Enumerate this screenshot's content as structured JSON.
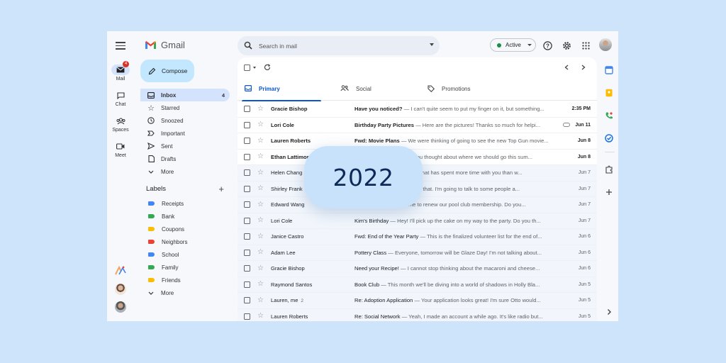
{
  "app": {
    "name": "Gmail"
  },
  "rail": {
    "mail": {
      "label": "Mail",
      "badge": "4"
    },
    "chat": {
      "label": "Chat"
    },
    "spaces": {
      "label": "Spaces"
    },
    "meet": {
      "label": "Meet"
    }
  },
  "compose_label": "Compose",
  "nav": [
    {
      "label": "Inbox",
      "count": "4",
      "icon": "inbox-icon",
      "selected": true
    },
    {
      "label": "Starred",
      "icon": "star-icon"
    },
    {
      "label": "Snoozed",
      "icon": "clock-icon"
    },
    {
      "label": "Important",
      "icon": "important-icon"
    },
    {
      "label": "Sent",
      "icon": "send-icon"
    },
    {
      "label": "Drafts",
      "icon": "draft-icon"
    },
    {
      "label": "More",
      "icon": "chevron-down-icon"
    }
  ],
  "labels": {
    "heading": "Labels",
    "items": [
      {
        "label": "Receipts",
        "color": "#4285f4"
      },
      {
        "label": "Bank",
        "color": "#34a853"
      },
      {
        "label": "Coupons",
        "color": "#fbbc04"
      },
      {
        "label": "Neighbors",
        "color": "#ea4335"
      },
      {
        "label": "School",
        "color": "#4285f4"
      },
      {
        "label": "Family",
        "color": "#34a853"
      },
      {
        "label": "Friends",
        "color": "#fbbc04"
      }
    ],
    "more": "More"
  },
  "search": {
    "placeholder": "Search in mail"
  },
  "status": {
    "label": "Active",
    "color": "#1e8e3e"
  },
  "tabs": [
    {
      "label": "Primary",
      "icon": "inbox-icon",
      "selected": true
    },
    {
      "label": "Social",
      "icon": "people-icon"
    },
    {
      "label": "Promotions",
      "icon": "tag-icon"
    }
  ],
  "emails": [
    {
      "sender": "Gracie Bishop",
      "subject": "Have you noticed?",
      "snippet": " — I can't quite seem to put my finger on it, but something...",
      "date": "2:35 PM",
      "unread": true
    },
    {
      "sender": "Lori Cole",
      "subject": "Birthday Party Pictures",
      "snippet": " — Here are the pictures! Thanks so much for helpi...",
      "date": "Jun 11",
      "unread": true,
      "attachment": true
    },
    {
      "sender": "Lauren Roberts",
      "subject": "Fwd: Movie Plans",
      "snippet": " — We were thinking of going to see the new Top Gun movie...",
      "date": "Jun 8",
      "unread": true
    },
    {
      "sender": "Ethan Lattimore",
      "subject": "",
      "snippet": "we you thought about where we should go this sum...",
      "date": "Jun 8",
      "unread": true
    },
    {
      "sender": "Helen Chang",
      "subject": "",
      "snippet": "nt, my hat has spent more time with you than w...",
      "date": "Jun 7",
      "unread": false
    },
    {
      "sender": "Shirley Frank",
      "subject": "",
      "snippet": "realize that. I'm going to talk to some people a...",
      "date": "Jun 7",
      "unread": false
    },
    {
      "sender": "Edward Wang",
      "subject": "",
      "snippet": "time to renew our pool club membership. Do you...",
      "date": "Jun 7",
      "unread": false
    },
    {
      "sender": "Lori Cole",
      "subject": "Kim's Birthday",
      "snippet": " — Hey! I'll pick up the cake on my way to the party. Do you th...",
      "date": "Jun 7",
      "unread": false
    },
    {
      "sender": "Janice Castro",
      "subject": "Fwd: End of the Year Party",
      "snippet": " — This is the finalized volunteer list for the end of...",
      "date": "Jun 6",
      "unread": false
    },
    {
      "sender": "Adam Lee",
      "subject": "Pottery Class",
      "snippet": " — Everyone, tomorrow will be Glaze Day! I'm not talking about...",
      "date": "Jun 6",
      "unread": false
    },
    {
      "sender": "Gracie Bishop",
      "subject": "Need your Recipe!",
      "snippet": " — I cannot stop thinking about the macaroni and cheese...",
      "date": "Jun 6",
      "unread": false
    },
    {
      "sender": "Raymond Santos",
      "subject": "Book Club",
      "snippet": " — This month we'll be diving into a world of shadows in Holly Bla...",
      "date": "Jun 5",
      "unread": false
    },
    {
      "sender": "Lauren, me",
      "count": "2",
      "subject": "Re: Adoption Application",
      "snippet": " — Your application looks great! I'm sure Otto would...",
      "date": "Jun 5",
      "unread": false
    },
    {
      "sender": "Lauren Roberts",
      "subject": "Re: Social Network",
      "snippet": " — Yeah, I made an account a while ago. It's like radio but...",
      "date": "Jun 5",
      "unread": false
    }
  ],
  "overlay": {
    "year": "2022"
  }
}
